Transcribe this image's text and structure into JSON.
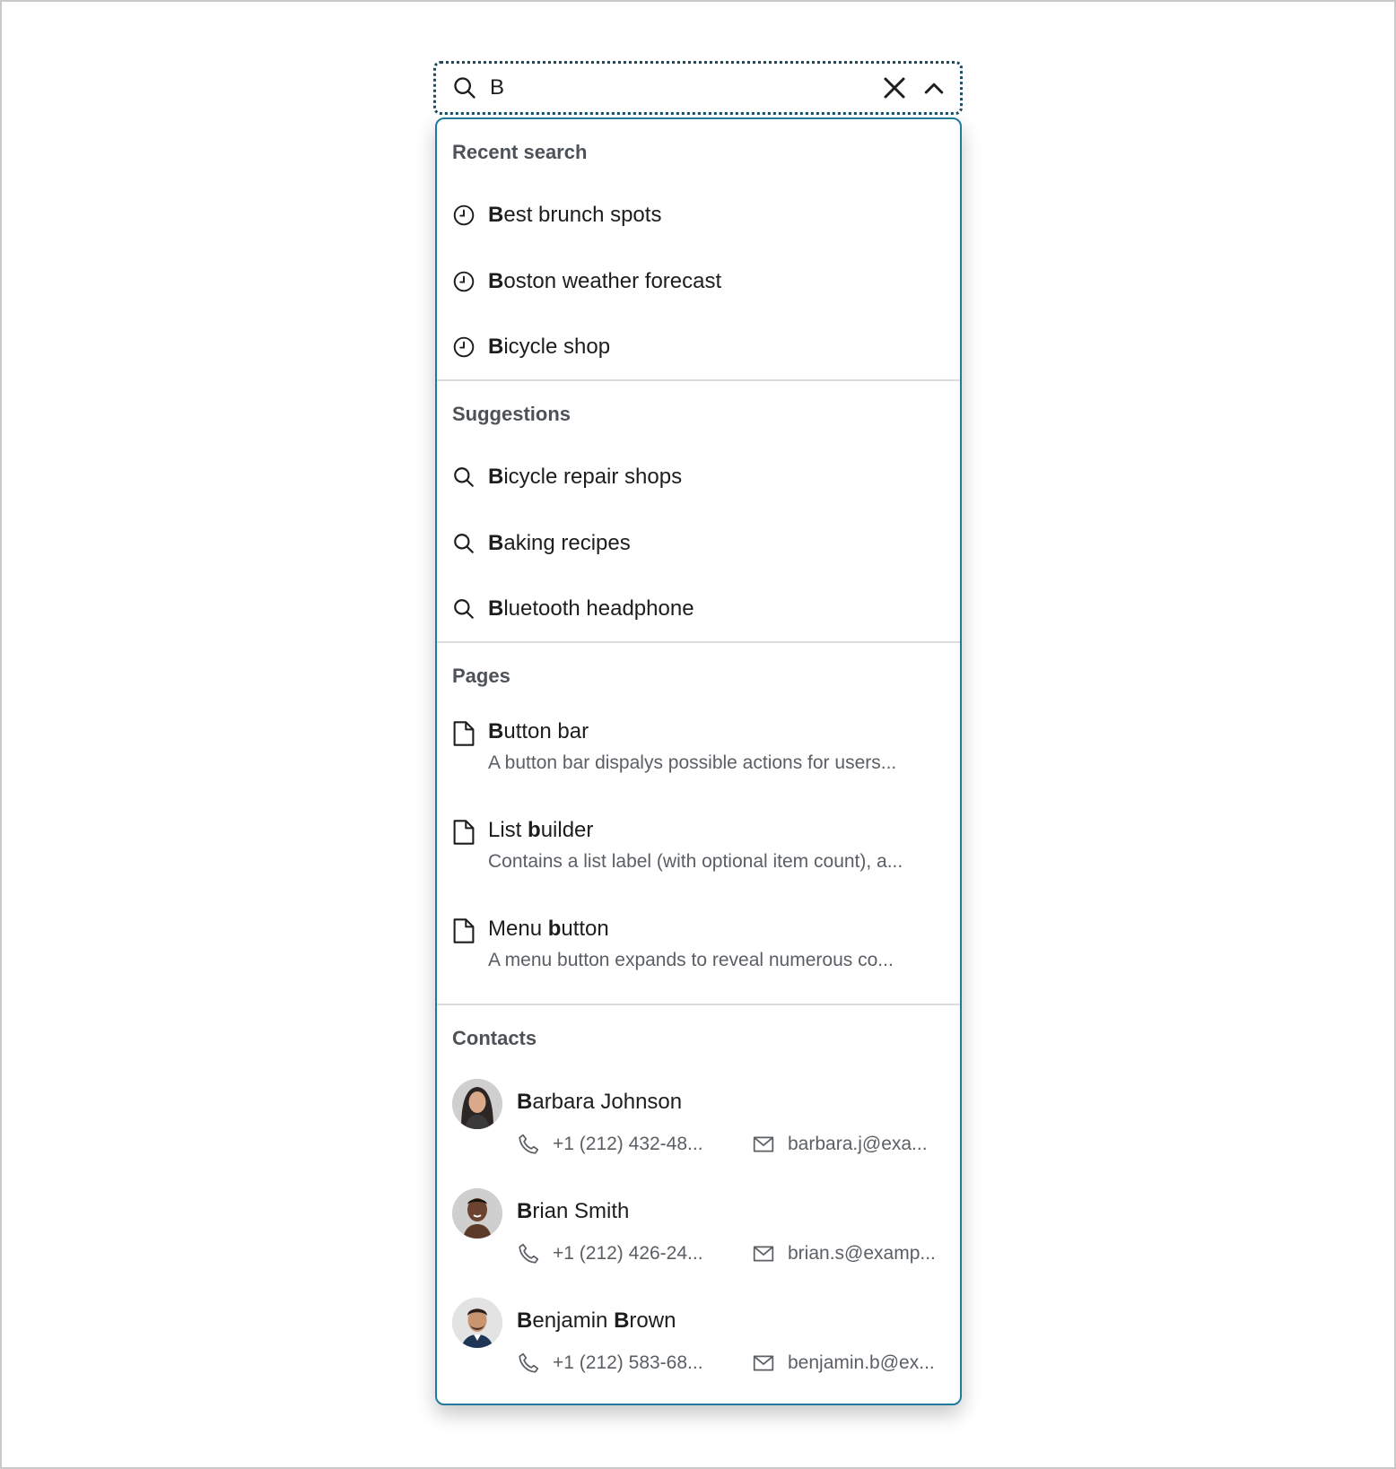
{
  "search": {
    "value": "B",
    "icons": {
      "lead": "search-icon",
      "clear": "close-icon",
      "collapse": "chevron-up-icon"
    }
  },
  "recent": {
    "heading": "Recent search",
    "items": [
      {
        "bold": "B",
        "rest": "est brunch spots",
        "icon": "clock-icon"
      },
      {
        "bold": "B",
        "rest": "oston weather forecast",
        "icon": "clock-icon"
      },
      {
        "bold": "B",
        "rest": "icycle shop",
        "icon": "clock-icon"
      }
    ]
  },
  "suggestions": {
    "heading": "Suggestions",
    "items": [
      {
        "bold": "B",
        "rest": "icycle repair shops",
        "icon": "search-icon"
      },
      {
        "bold": "B",
        "rest": "aking recipes",
        "icon": "search-icon"
      },
      {
        "bold": "B",
        "rest": "luetooth headphone",
        "icon": "search-icon"
      }
    ]
  },
  "pages": {
    "heading": "Pages",
    "items": [
      {
        "pre": "",
        "bold": "B",
        "rest": "utton bar",
        "desc": "A button bar dispalys possible actions for users...",
        "icon": "document-icon"
      },
      {
        "pre": "List ",
        "bold": "b",
        "rest": "uilder",
        "desc": "Contains a list label (with optional item count), a...",
        "icon": "document-icon"
      },
      {
        "pre": "Menu ",
        "bold": "b",
        "rest": "utton",
        "desc": "A menu button expands to reveal numerous co...",
        "icon": "document-icon"
      }
    ]
  },
  "contacts": {
    "heading": "Contacts",
    "items": [
      {
        "b1": "B",
        "r1": "arbara Johnson",
        "b2": "",
        "r2": "",
        "phone": "+1 (212) 432-48...",
        "email": "barbara.j@exa..."
      },
      {
        "b1": "B",
        "r1": "rian Smith",
        "b2": "",
        "r2": "",
        "phone": "+1 (212) 426-24...",
        "email": "brian.s@examp..."
      },
      {
        "b1": "B",
        "r1": "enjamin ",
        "b2": "B",
        "r2": "rown",
        "phone": "+1 (212) 583-68...",
        "email": "benjamin.b@ex..."
      }
    ]
  },
  "colors": {
    "focus": "#1b4c63",
    "dropdownBorder": "#1f7a9c",
    "heading": "#4c5257",
    "secondary": "#5a5f64"
  }
}
